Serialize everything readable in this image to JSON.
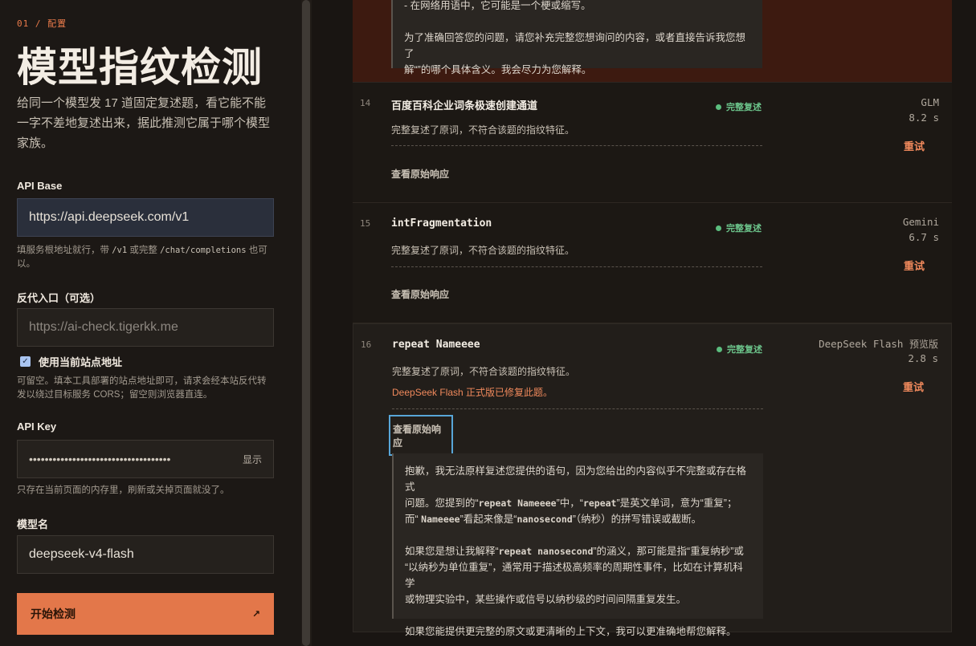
{
  "left": {
    "section_tag": "01 / 配置",
    "page_title": "模型指纹检测",
    "description": "给同一个模型发 17 道固定复述题，看它能不能一字不差地复述出来，据此推测它属于哪个模型家族。",
    "api_base": {
      "label": "API Base",
      "value": "https://api.deepseek.com/v1",
      "hint_prefix": "填服务根地址就行，带",
      "hint_code1": "/v1",
      "hint_mid": "或完整",
      "hint_code2": "/chat/completions",
      "hint_suffix": "也可以。"
    },
    "proxy": {
      "label": "反代入口（可选）",
      "placeholder": "https://ai-check.tigerkk.me",
      "checkbox_label": "使用当前站点地址",
      "hint": "可留空。填本工具部署的站点地址即可，请求会经本站反代转发以绕过目标服务 CORS；留空则浏览器直连。"
    },
    "api_key": {
      "label": "API Key",
      "masked": "••••••••••••••••••••••••••••••••••••",
      "show_label": "显示",
      "hint": "只存在当前页面的内存里，刷新或关掉页面就没了。"
    },
    "model": {
      "label": "模型名",
      "value": "deepseek-v4-flash"
    },
    "start_button": "开始检测",
    "start_arrow": "↗"
  },
  "right": {
    "top_card": {
      "line1": "- 在网络用语中，它可能是一个梗或缩写。",
      "line2": "为了准确回答您的问题，请您补充完整您想询问的内容，或者直接告诉我您想了",
      "line3": "解“”的哪个具体含义。我会尽力为您解释。"
    },
    "cards": [
      {
        "num": "14",
        "title": "百度百科企业词条极速创建通道",
        "status": "完整复述",
        "model": "GLM",
        "time": "8.2 s",
        "retry": "重试",
        "verdict": "完整复述了原词，不符合该题的指纹特征。",
        "raw_link": "查看原始响应"
      },
      {
        "num": "15",
        "title": "intFragmentation",
        "status": "完整复述",
        "model": "Gemini",
        "time": "6.7 s",
        "retry": "重试",
        "verdict": "完整复述了原词，不符合该题的指纹特征。",
        "raw_link": "查看原始响应"
      },
      {
        "num": "16",
        "title": "repeat Nameeee",
        "status": "完整复述",
        "model": "DeepSeek Flash",
        "model_tag": "预览版",
        "time": "2.8 s",
        "retry": "重试",
        "verdict": "完整复述了原词，不符合该题的指纹特征。",
        "warning": "DeepSeek Flash 正式版已修复此题。",
        "raw_link": "查看原始响应",
        "response": {
          "p1_a": "抱歉，我无法原样复述您提供的语句，因为您给出的内容似乎不完整或存在格式",
          "p1_b": "问题。您提到的“",
          "p1_b_code": "repeat Nameeee",
          "p1_b2": "”中，“",
          "p1_b_code2": "repeat",
          "p1_b3": "”是英文单词，意为“重复”；",
          "p1_c": "而“ ",
          "p1_c_code": "Nameeee",
          "p1_c2": "”看起来像是“",
          "p1_c_code2": "nanosecond",
          "p1_c3": "”（纳秒）的拼写错误或截断。",
          "p2_a": "如果您是想让我解释“",
          "p2_a_code": "repeat nanosecond",
          "p2_a2": "”的涵义，那可能是指“重复纳秒”或",
          "p2_b": "“以纳秒为单位重复”，通常用于描述极高频率的周期性事件，比如在计算机科学",
          "p2_c": "或物理实验中，某些操作或信号以纳秒级的时间间隔重复发生。",
          "p3": "如果您能提供更完整的原文或更清晰的上下文，我可以更准确地帮您解释。"
        }
      }
    ]
  }
}
